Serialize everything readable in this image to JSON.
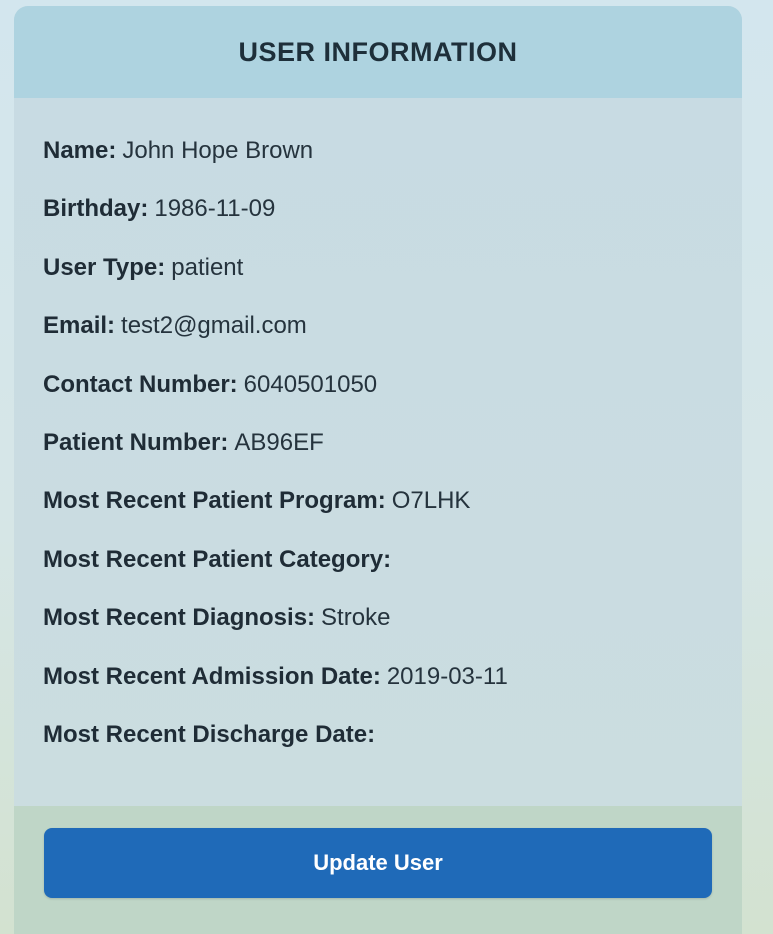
{
  "card": {
    "title": "USER INFORMATION"
  },
  "fields": [
    {
      "label": "Name:",
      "value": "John Hope Brown"
    },
    {
      "label": "Birthday:",
      "value": "1986-11-09"
    },
    {
      "label": "User Type:",
      "value": "patient"
    },
    {
      "label": "Email:",
      "value": "test2@gmail.com"
    },
    {
      "label": "Contact Number:",
      "value": "6040501050"
    },
    {
      "label": "Patient Number:",
      "value": "AB96EF"
    },
    {
      "label": "Most Recent Patient Program:",
      "value": "O7LHK"
    },
    {
      "label": "Most Recent Patient Category:",
      "value": ""
    },
    {
      "label": "Most Recent Diagnosis:",
      "value": "Stroke"
    },
    {
      "label": "Most Recent Admission Date:",
      "value": "2019-03-11"
    },
    {
      "label": "Most Recent Discharge Date:",
      "value": ""
    }
  ],
  "actions": {
    "update_label": "Update User"
  },
  "colors": {
    "header_bg": "#aed3e0",
    "body_bg": "#c9dde3",
    "footer_bg": "#bfd6c7",
    "button_bg": "#1f6ab8",
    "button_text": "#ffffff"
  }
}
